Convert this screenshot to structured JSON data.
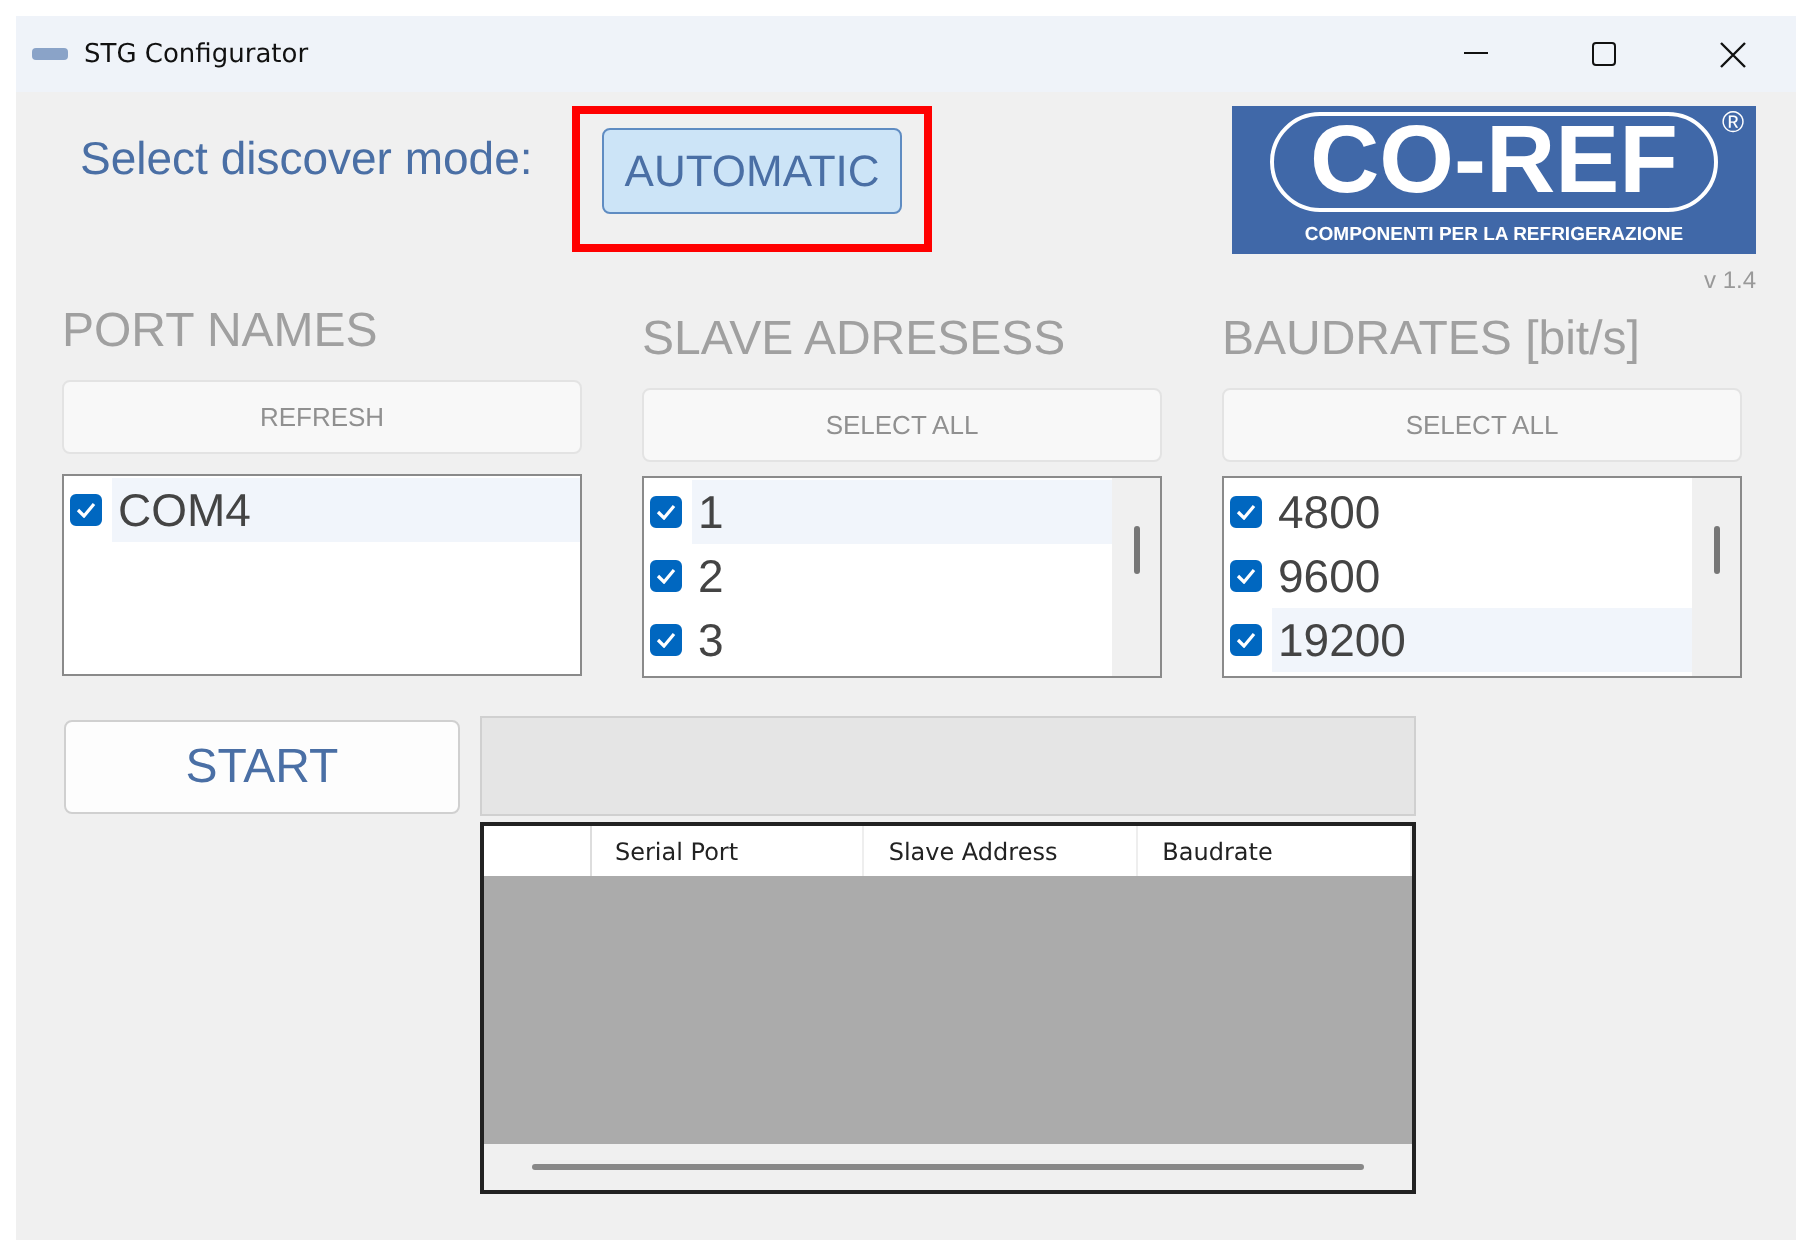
{
  "window": {
    "title": "STG Configurator"
  },
  "mode": {
    "label": "Select discover mode:",
    "button": "AUTOMATIC",
    "highlighted": true
  },
  "logo": {
    "name": "CO-REF",
    "mark": "®",
    "tagline": "COMPONENTI PER LA REFRIGERAZIONE",
    "version": "v 1.4"
  },
  "panels": [
    {
      "heading": "PORT NAMES",
      "button": "REFRESH",
      "scrollable": false,
      "items": [
        {
          "label": "COM4",
          "checked": true,
          "selected": true
        }
      ]
    },
    {
      "heading": "SLAVE ADRESESS",
      "button": "SELECT ALL",
      "scrollable": true,
      "items": [
        {
          "label": "1",
          "checked": true,
          "selected": true
        },
        {
          "label": "2",
          "checked": true,
          "selected": false
        },
        {
          "label": "3",
          "checked": true,
          "selected": false
        }
      ]
    },
    {
      "heading": "BAUDRATES [bit/s]",
      "button": "SELECT ALL",
      "scrollable": true,
      "items": [
        {
          "label": "4800",
          "checked": true,
          "selected": false
        },
        {
          "label": "9600",
          "checked": true,
          "selected": false
        },
        {
          "label": "19200",
          "checked": true,
          "selected": true
        }
      ]
    }
  ],
  "start_button": "START",
  "table": {
    "columns": [
      "Serial Port",
      "Slave Address",
      "Baudrate"
    ]
  }
}
